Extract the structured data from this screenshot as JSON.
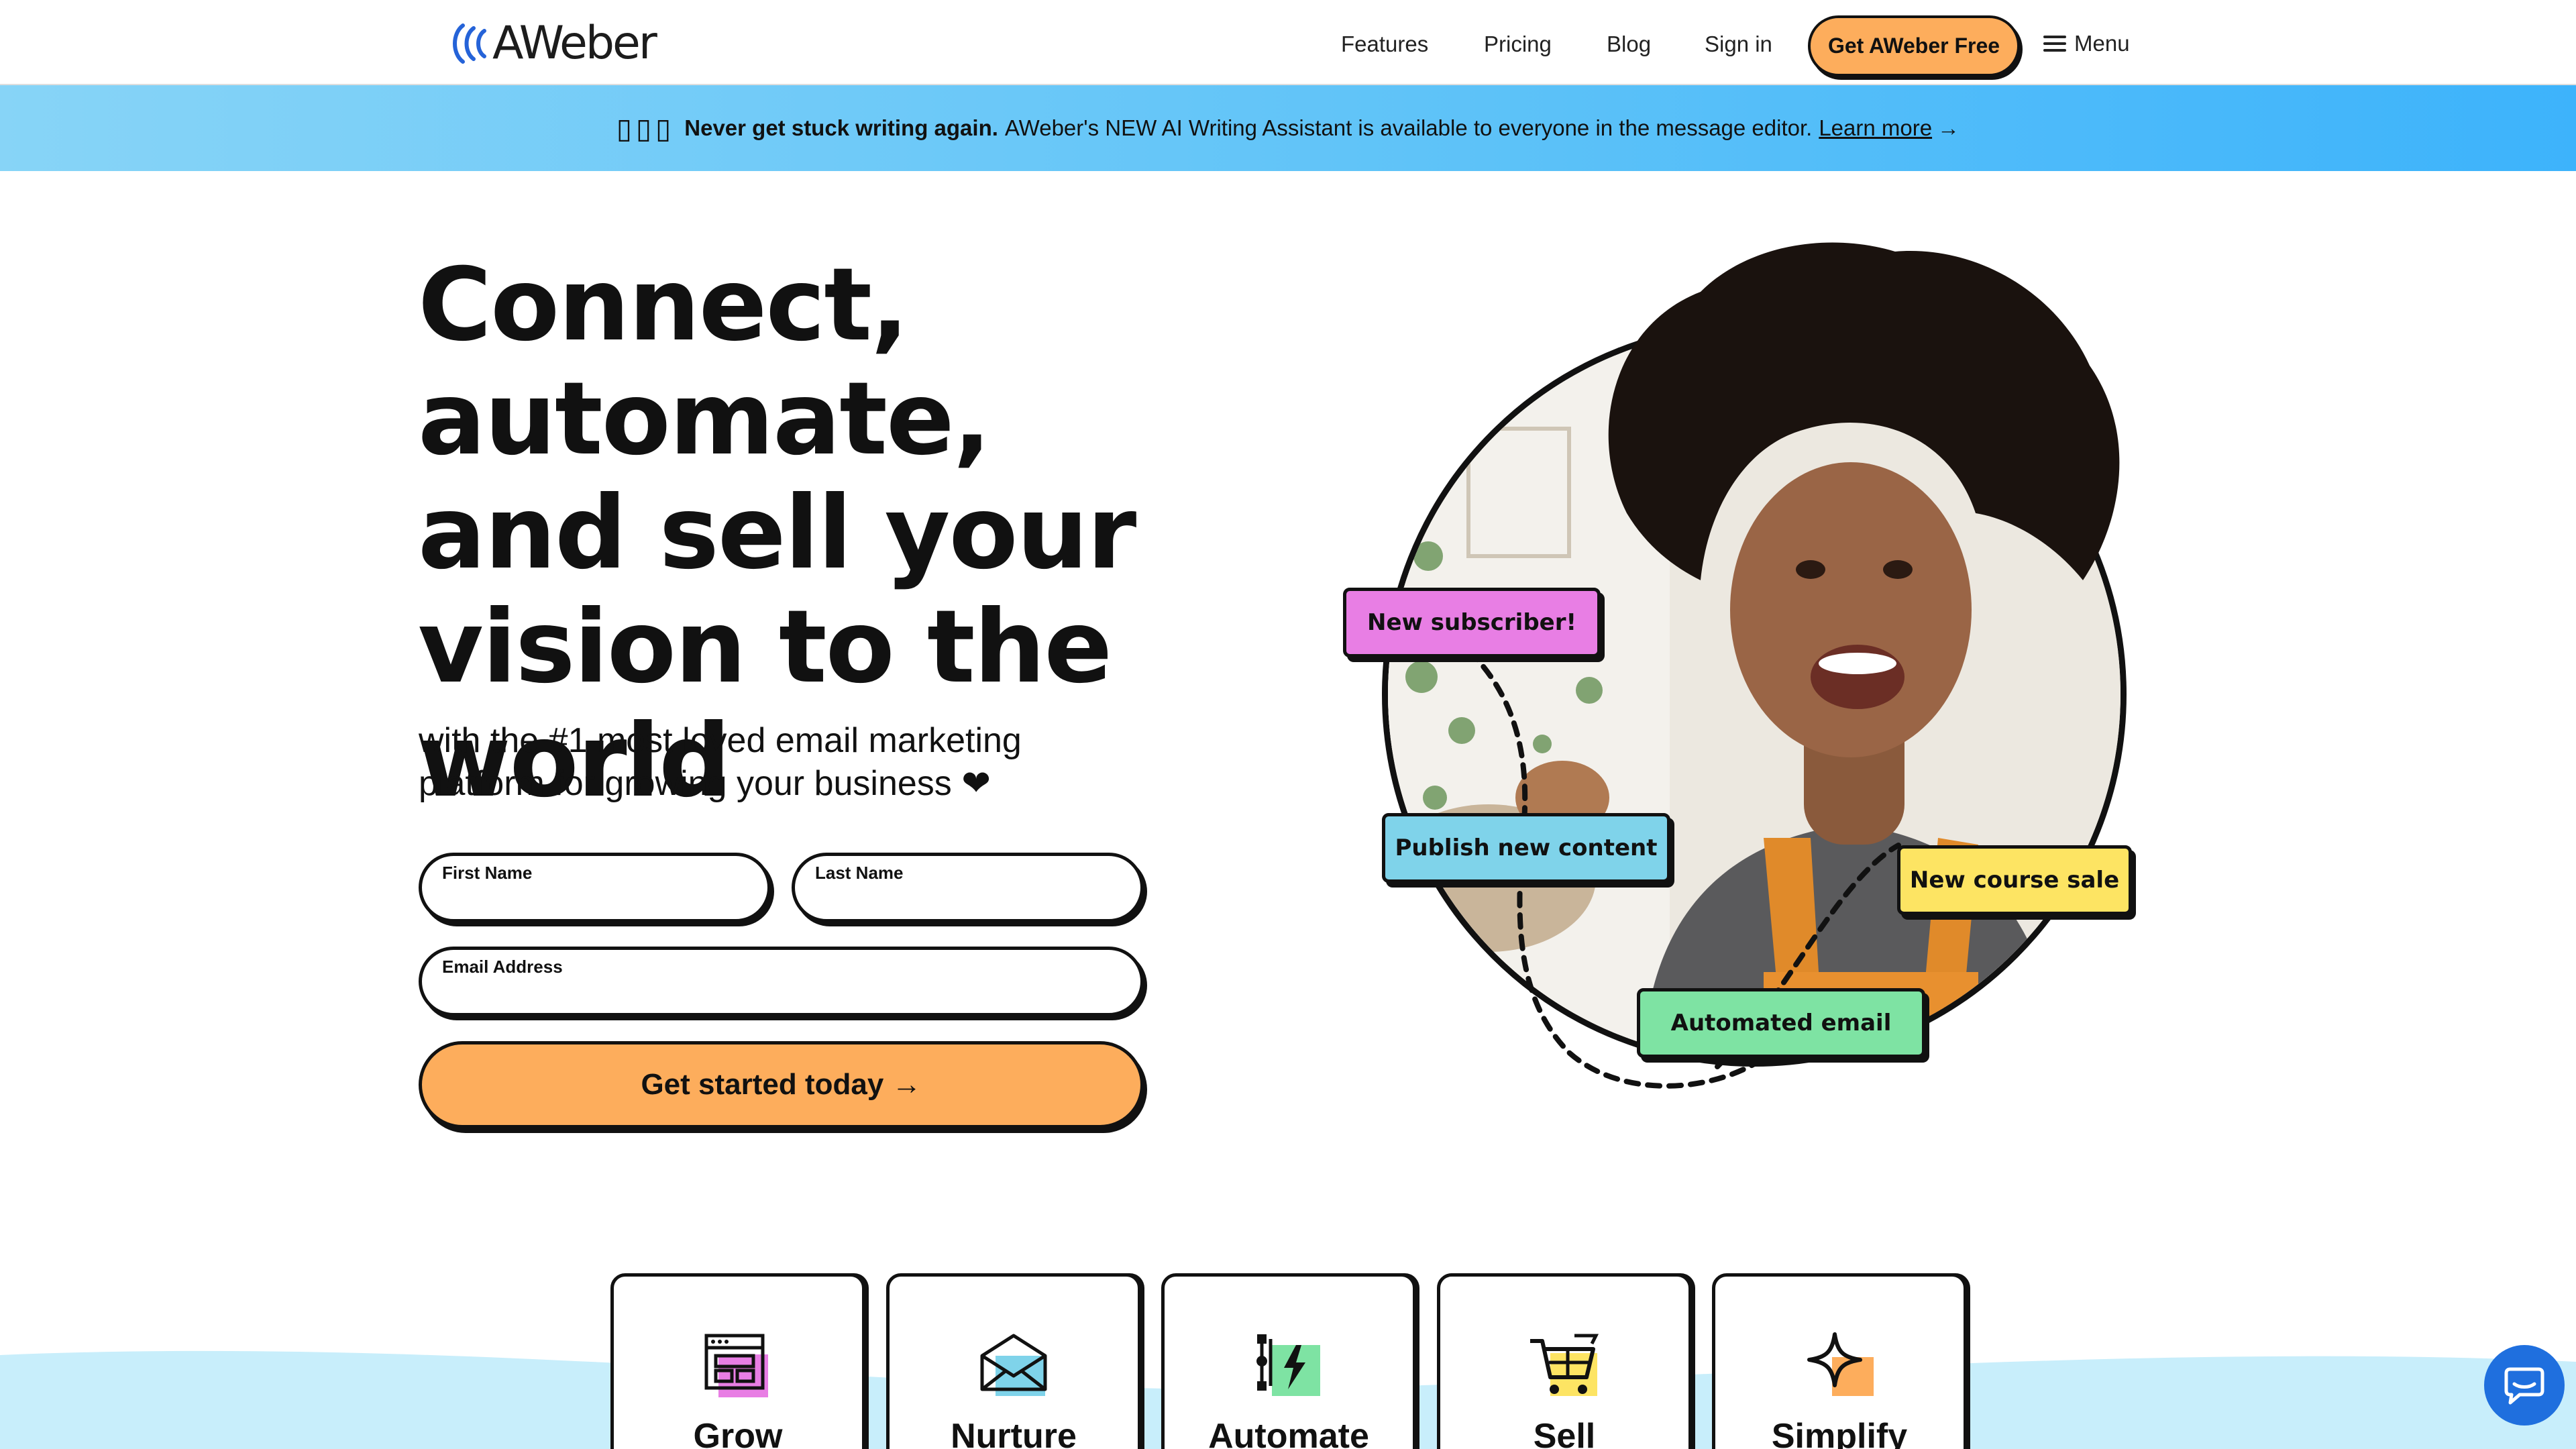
{
  "header": {
    "logo_text": "AWeber",
    "nav": [
      {
        "label": "Features"
      },
      {
        "label": "Pricing"
      },
      {
        "label": "Blog"
      },
      {
        "label": "Sign in"
      }
    ],
    "cta_label": "Get AWeber Free",
    "menu_label": "Menu"
  },
  "banner": {
    "glyphs": "▯▯▯",
    "bold_text": "Never get stuck writing again.",
    "text": "AWeber's NEW AI Writing Assistant is available to everyone in the message editor.",
    "link_text": "Learn more",
    "arrow": "→"
  },
  "hero": {
    "title": "Connect, automate, and sell your vision to the world",
    "subtitle": "with the #1 most loved email marketing platform for growing your business ❤"
  },
  "form": {
    "first_name_label": "First Name",
    "last_name_label": "Last Name",
    "email_label": "Email Address",
    "first_name_value": "",
    "last_name_value": "",
    "email_value": "",
    "submit_label": "Get started today →"
  },
  "tags": {
    "new_subscriber": "New subscriber!",
    "publish_content": "Publish new content",
    "course_sale": "New course sale",
    "automated_email": "Automated email"
  },
  "features": [
    {
      "label": "Grow",
      "icon": "browser-window-icon"
    },
    {
      "label": "Nurture",
      "icon": "envelope-icon"
    },
    {
      "label": "Automate",
      "icon": "workflow-bolt-icon"
    },
    {
      "label": "Sell",
      "icon": "shopping-cart-icon"
    },
    {
      "label": "Simplify",
      "icon": "sparkle-icon"
    }
  ],
  "colors": {
    "accent_orange": "#fdad5c",
    "banner_blue": "#5fc3f8",
    "tag_pink": "#e87ee4",
    "tag_cyan": "#7fd3ea",
    "tag_yellow": "#fde463",
    "tag_green": "#7ee3a3",
    "chat_blue": "#1f6fde"
  }
}
